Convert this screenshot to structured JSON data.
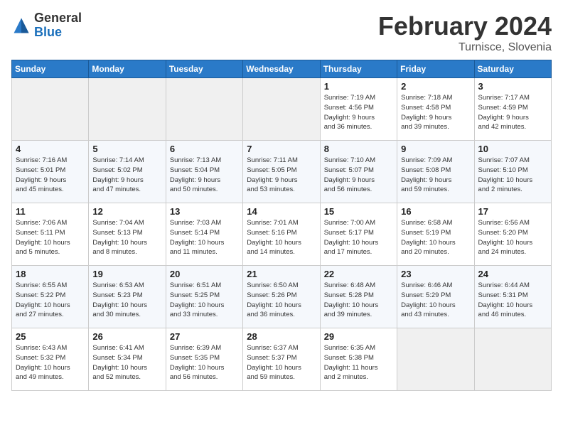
{
  "header": {
    "logo_general": "General",
    "logo_blue": "Blue",
    "month_year": "February 2024",
    "location": "Turnisce, Slovenia"
  },
  "weekdays": [
    "Sunday",
    "Monday",
    "Tuesday",
    "Wednesday",
    "Thursday",
    "Friday",
    "Saturday"
  ],
  "weeks": [
    [
      {
        "day": "",
        "info": ""
      },
      {
        "day": "",
        "info": ""
      },
      {
        "day": "",
        "info": ""
      },
      {
        "day": "",
        "info": ""
      },
      {
        "day": "1",
        "info": "Sunrise: 7:19 AM\nSunset: 4:56 PM\nDaylight: 9 hours\nand 36 minutes."
      },
      {
        "day": "2",
        "info": "Sunrise: 7:18 AM\nSunset: 4:58 PM\nDaylight: 9 hours\nand 39 minutes."
      },
      {
        "day": "3",
        "info": "Sunrise: 7:17 AM\nSunset: 4:59 PM\nDaylight: 9 hours\nand 42 minutes."
      }
    ],
    [
      {
        "day": "4",
        "info": "Sunrise: 7:16 AM\nSunset: 5:01 PM\nDaylight: 9 hours\nand 45 minutes."
      },
      {
        "day": "5",
        "info": "Sunrise: 7:14 AM\nSunset: 5:02 PM\nDaylight: 9 hours\nand 47 minutes."
      },
      {
        "day": "6",
        "info": "Sunrise: 7:13 AM\nSunset: 5:04 PM\nDaylight: 9 hours\nand 50 minutes."
      },
      {
        "day": "7",
        "info": "Sunrise: 7:11 AM\nSunset: 5:05 PM\nDaylight: 9 hours\nand 53 minutes."
      },
      {
        "day": "8",
        "info": "Sunrise: 7:10 AM\nSunset: 5:07 PM\nDaylight: 9 hours\nand 56 minutes."
      },
      {
        "day": "9",
        "info": "Sunrise: 7:09 AM\nSunset: 5:08 PM\nDaylight: 9 hours\nand 59 minutes."
      },
      {
        "day": "10",
        "info": "Sunrise: 7:07 AM\nSunset: 5:10 PM\nDaylight: 10 hours\nand 2 minutes."
      }
    ],
    [
      {
        "day": "11",
        "info": "Sunrise: 7:06 AM\nSunset: 5:11 PM\nDaylight: 10 hours\nand 5 minutes."
      },
      {
        "day": "12",
        "info": "Sunrise: 7:04 AM\nSunset: 5:13 PM\nDaylight: 10 hours\nand 8 minutes."
      },
      {
        "day": "13",
        "info": "Sunrise: 7:03 AM\nSunset: 5:14 PM\nDaylight: 10 hours\nand 11 minutes."
      },
      {
        "day": "14",
        "info": "Sunrise: 7:01 AM\nSunset: 5:16 PM\nDaylight: 10 hours\nand 14 minutes."
      },
      {
        "day": "15",
        "info": "Sunrise: 7:00 AM\nSunset: 5:17 PM\nDaylight: 10 hours\nand 17 minutes."
      },
      {
        "day": "16",
        "info": "Sunrise: 6:58 AM\nSunset: 5:19 PM\nDaylight: 10 hours\nand 20 minutes."
      },
      {
        "day": "17",
        "info": "Sunrise: 6:56 AM\nSunset: 5:20 PM\nDaylight: 10 hours\nand 24 minutes."
      }
    ],
    [
      {
        "day": "18",
        "info": "Sunrise: 6:55 AM\nSunset: 5:22 PM\nDaylight: 10 hours\nand 27 minutes."
      },
      {
        "day": "19",
        "info": "Sunrise: 6:53 AM\nSunset: 5:23 PM\nDaylight: 10 hours\nand 30 minutes."
      },
      {
        "day": "20",
        "info": "Sunrise: 6:51 AM\nSunset: 5:25 PM\nDaylight: 10 hours\nand 33 minutes."
      },
      {
        "day": "21",
        "info": "Sunrise: 6:50 AM\nSunset: 5:26 PM\nDaylight: 10 hours\nand 36 minutes."
      },
      {
        "day": "22",
        "info": "Sunrise: 6:48 AM\nSunset: 5:28 PM\nDaylight: 10 hours\nand 39 minutes."
      },
      {
        "day": "23",
        "info": "Sunrise: 6:46 AM\nSunset: 5:29 PM\nDaylight: 10 hours\nand 43 minutes."
      },
      {
        "day": "24",
        "info": "Sunrise: 6:44 AM\nSunset: 5:31 PM\nDaylight: 10 hours\nand 46 minutes."
      }
    ],
    [
      {
        "day": "25",
        "info": "Sunrise: 6:43 AM\nSunset: 5:32 PM\nDaylight: 10 hours\nand 49 minutes."
      },
      {
        "day": "26",
        "info": "Sunrise: 6:41 AM\nSunset: 5:34 PM\nDaylight: 10 hours\nand 52 minutes."
      },
      {
        "day": "27",
        "info": "Sunrise: 6:39 AM\nSunset: 5:35 PM\nDaylight: 10 hours\nand 56 minutes."
      },
      {
        "day": "28",
        "info": "Sunrise: 6:37 AM\nSunset: 5:37 PM\nDaylight: 10 hours\nand 59 minutes."
      },
      {
        "day": "29",
        "info": "Sunrise: 6:35 AM\nSunset: 5:38 PM\nDaylight: 11 hours\nand 2 minutes."
      },
      {
        "day": "",
        "info": ""
      },
      {
        "day": "",
        "info": ""
      }
    ]
  ]
}
